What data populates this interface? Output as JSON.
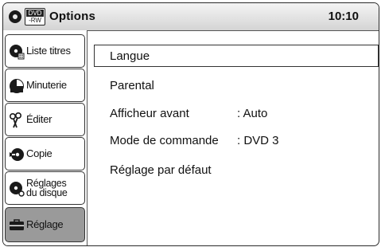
{
  "header": {
    "media_badge_top": "DVD",
    "media_badge_bottom": "-RW",
    "title": "Options",
    "clock": "10:10"
  },
  "sidebar": {
    "tabs": [
      {
        "label": "Liste titres",
        "icon": "title-list-icon",
        "selected": false
      },
      {
        "label": "Minuterie",
        "icon": "timer-icon",
        "selected": false
      },
      {
        "label": "Éditer",
        "icon": "scissors-icon",
        "selected": false
      },
      {
        "label": "Copie",
        "icon": "dub-icon",
        "selected": false
      },
      {
        "label_line1": "Réglages",
        "label_line2": "du disque",
        "icon": "disc-settings-icon",
        "selected": false
      },
      {
        "label": "Réglage",
        "icon": "toolbox-icon",
        "selected": true
      }
    ]
  },
  "menu": {
    "items": [
      {
        "label": "Langue",
        "value": ""
      },
      {
        "label": "Parental",
        "value": ""
      },
      {
        "label": "Afficheur avant",
        "value": ":  Auto"
      },
      {
        "label": "Mode de commande",
        "value": ":  DVD 3"
      },
      {
        "label": "Réglage par défaut",
        "value": ""
      }
    ]
  }
}
